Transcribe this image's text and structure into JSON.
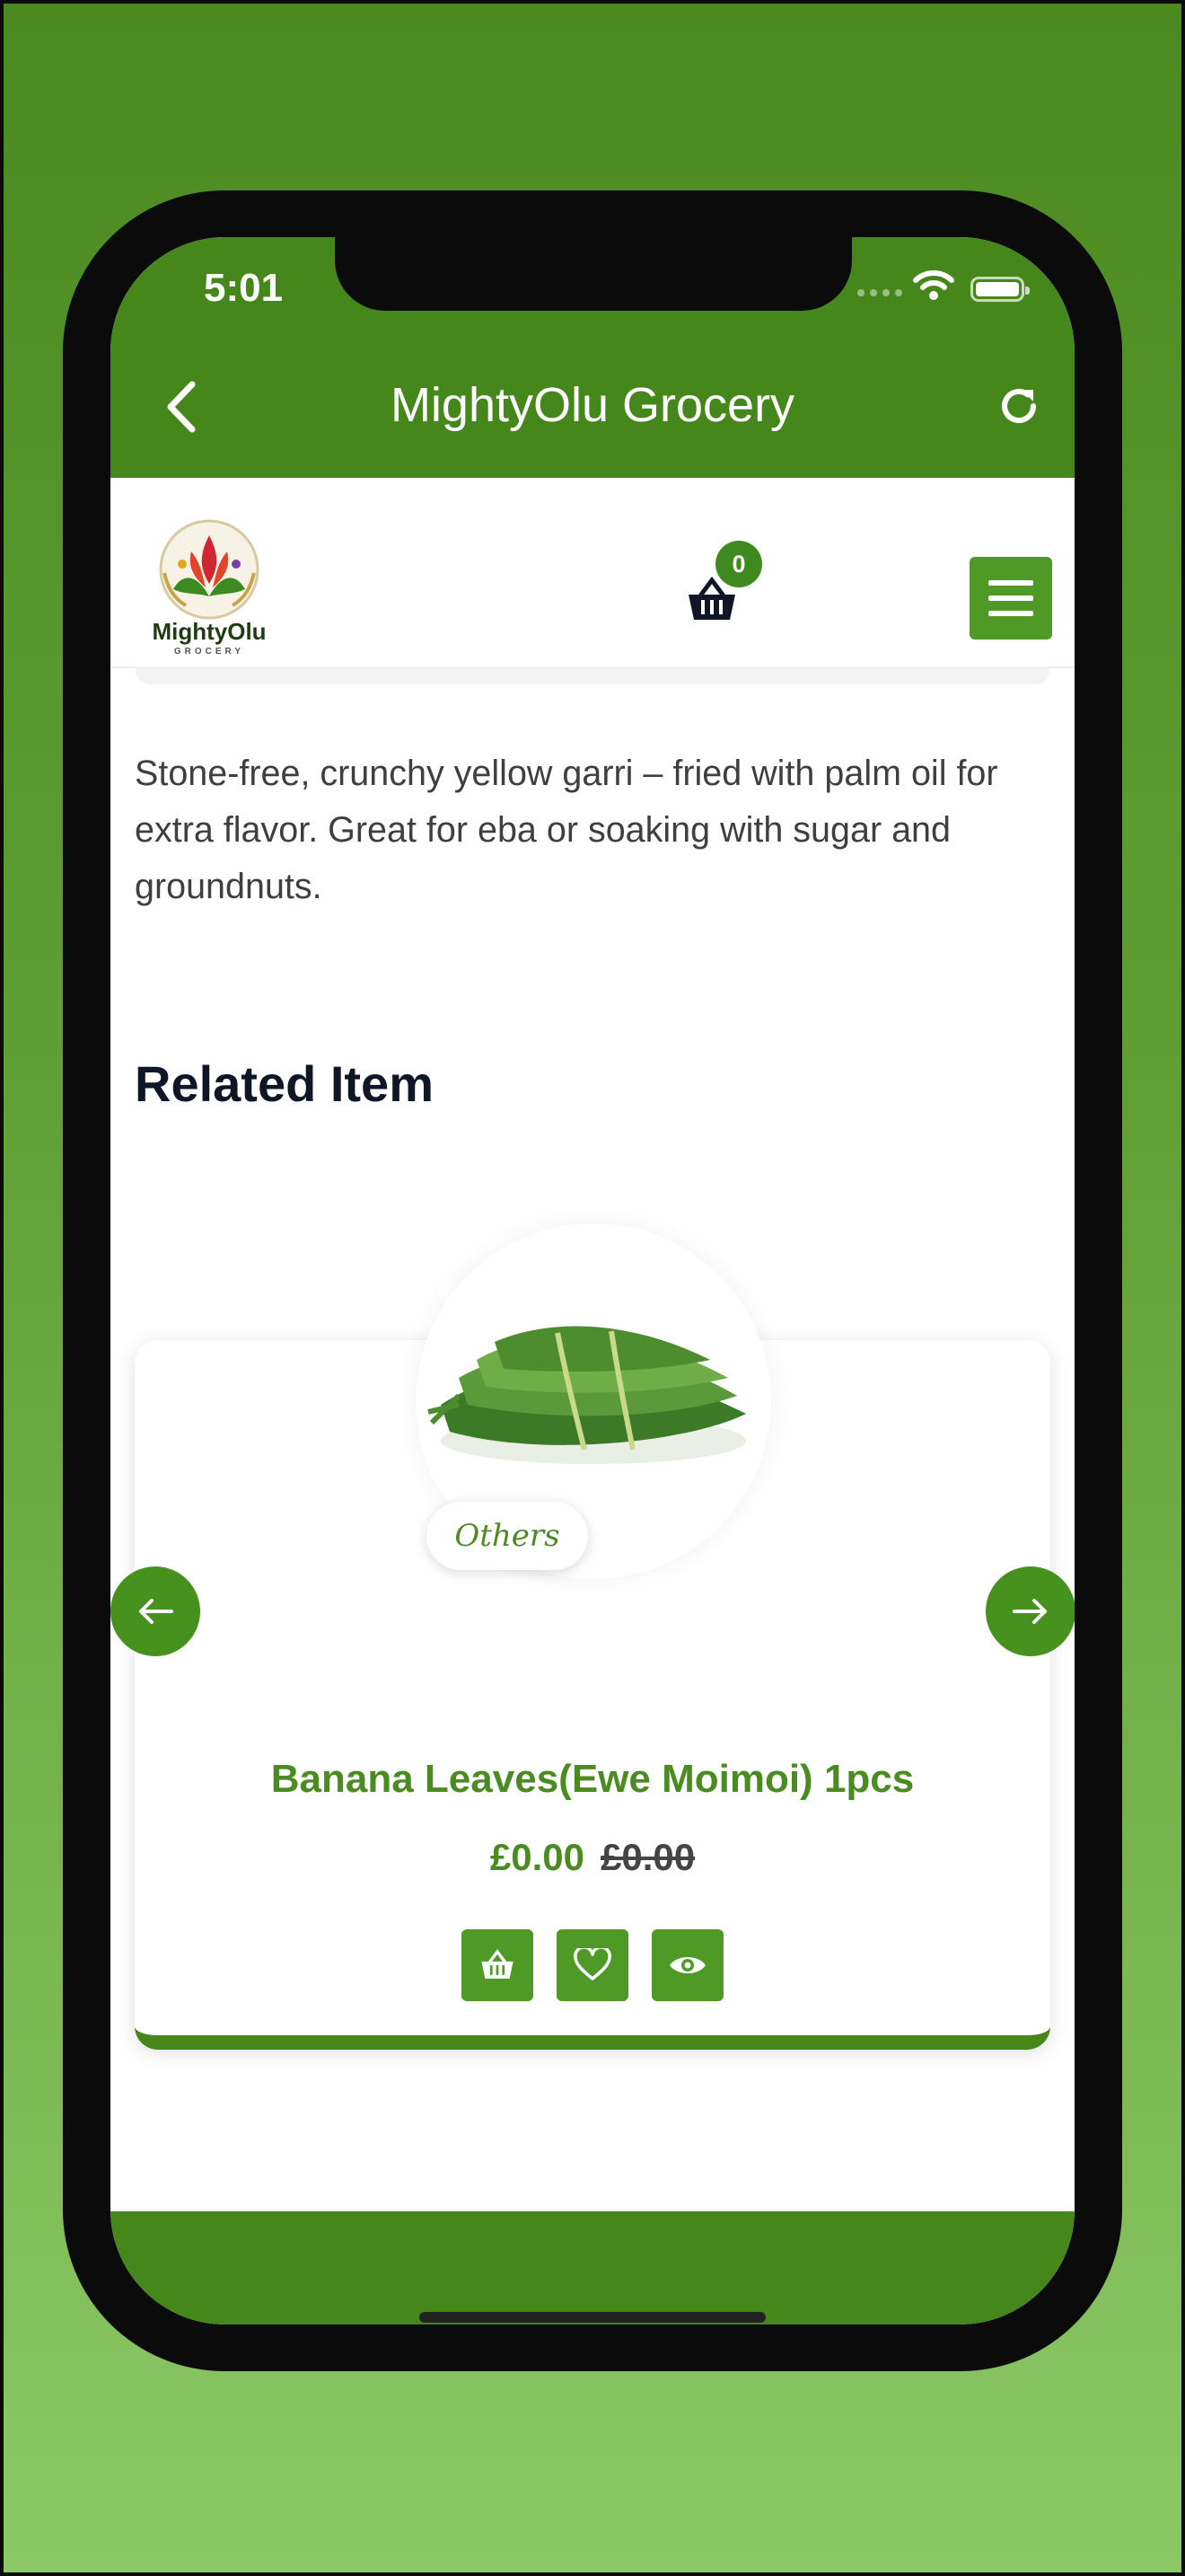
{
  "status_bar": {
    "time": "5:01"
  },
  "nav": {
    "title": "MightyOlu Grocery"
  },
  "header": {
    "logo_text": "MightyOlu",
    "logo_subtext": "GROCERY",
    "cart_count": "0"
  },
  "product": {
    "description": "Stone-free, crunchy yellow garri – fried with palm oil for extra flavor. Great for eba or soaking with sugar and groundnuts."
  },
  "related": {
    "title": "Related Item",
    "items": [
      {
        "category": "Others",
        "name": "Banana Leaves(Ewe Moimoi) 1pcs",
        "price": "£0.00",
        "old_price": "£0.00"
      }
    ]
  },
  "colors": {
    "brand_green": "#46871c",
    "button_green": "#4f9a26",
    "heading": "#0f1626"
  }
}
